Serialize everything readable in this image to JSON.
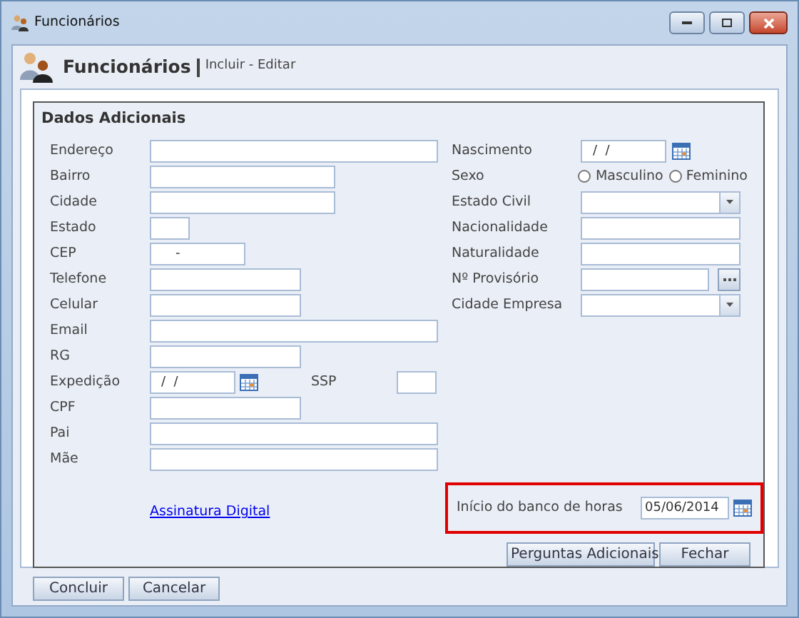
{
  "window": {
    "title": "Funcionários"
  },
  "header": {
    "title": "Funcionários",
    "subtitle": "Incluir - Editar"
  },
  "dialog": {
    "title": "Dados Adicionais",
    "left_fields": [
      {
        "label": "Endereço",
        "kind": "wide"
      },
      {
        "label": "Bairro",
        "kind": "medium"
      },
      {
        "label": "Cidade",
        "kind": "medium"
      },
      {
        "label": "Estado",
        "kind": "tiny"
      },
      {
        "label": "CEP",
        "kind": "masked",
        "value": "-"
      },
      {
        "label": "Telefone",
        "kind": "short"
      },
      {
        "label": "Celular",
        "kind": "short"
      },
      {
        "label": "Email",
        "kind": "wide"
      },
      {
        "label": "RG",
        "kind": "short"
      },
      {
        "label": "Expedição",
        "kind": "date",
        "value": "/  /",
        "extra_label": "SSP"
      },
      {
        "label": "CPF",
        "kind": "short"
      },
      {
        "label": "Pai",
        "kind": "wide"
      },
      {
        "label": "Mãe",
        "kind": "wide"
      }
    ],
    "right_fields": [
      {
        "label": "Nascimento",
        "kind": "date",
        "value": "/  /"
      },
      {
        "label": "Sexo",
        "kind": "radio",
        "options": [
          {
            "label": "Masculino",
            "selected": false
          },
          {
            "label": "Feminino",
            "selected": false
          }
        ]
      },
      {
        "label": "Estado Civil",
        "kind": "select"
      },
      {
        "label": "Nacionalidade",
        "kind": "text"
      },
      {
        "label": "Naturalidade",
        "kind": "text"
      },
      {
        "label": "Nº Provisório",
        "kind": "lookup"
      },
      {
        "label": "Cidade Empresa",
        "kind": "select"
      }
    ],
    "link": "Assinatura Digital",
    "bank_hours": {
      "label": "Início do banco de horas",
      "value": "05/06/2014",
      "highlighted": true
    },
    "buttons": [
      "Perguntas Adicionais",
      "Fechar"
    ]
  },
  "buttons": [
    "Concluir",
    "Cancelar"
  ]
}
